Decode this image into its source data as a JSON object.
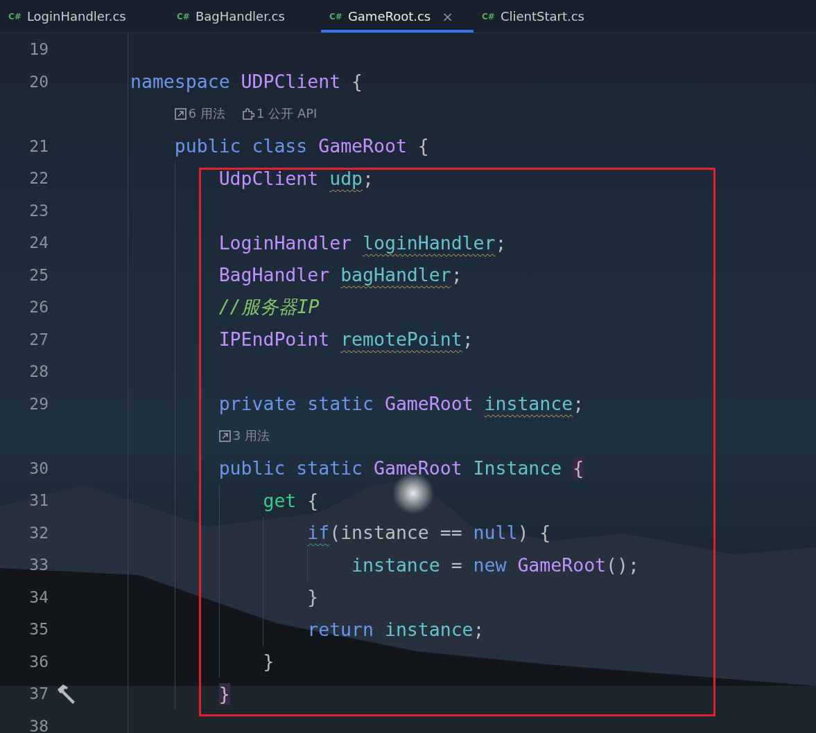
{
  "tabs": [
    {
      "label": "LoginHandler.cs",
      "badge": "C#",
      "selected": false
    },
    {
      "label": "BagHandler.cs",
      "badge": "C#",
      "selected": false
    },
    {
      "label": "GameRoot.cs",
      "badge": "C#",
      "selected": true,
      "close": "×"
    },
    {
      "label": "ClientStart.cs",
      "badge": "C#",
      "selected": false
    }
  ],
  "lines": [
    {
      "kind": "code",
      "number": "19"
    },
    {
      "kind": "code",
      "number": "20",
      "tokens": [
        {
          "text": "namespace",
          "kind": "keyword"
        },
        {
          "text": "UDPClient",
          "kind": "type"
        },
        {
          "text": "{",
          "kind": "punct"
        }
      ],
      "children": [
        {
          "kind": "hint",
          "hints": [
            {
              "kind": "usages",
              "text": "6 用法"
            },
            {
              "kind": "api",
              "text": "1 公开 API"
            }
          ]
        },
        {
          "kind": "code",
          "number": "21",
          "tokens": [
            {
              "text": "public",
              "kind": "keyword"
            },
            {
              "text": "class",
              "kind": "keyword"
            },
            {
              "text": "GameRoot",
              "kind": "type"
            },
            {
              "text": "{",
              "kind": "punct"
            }
          ],
          "children": [
            {
              "kind": "code",
              "number": "22",
              "tokens": [
                {
                  "text": "UdpClient",
                  "kind": "type"
                },
                {
                  "text": "udp",
                  "kind": "field",
                  "squiggly": true,
                  "after": ";"
                }
              ]
            },
            {
              "kind": "code",
              "number": "23"
            },
            {
              "kind": "code",
              "number": "24",
              "tokens": [
                {
                  "text": "LoginHandler",
                  "kind": "type"
                },
                {
                  "text": "loginHandler",
                  "kind": "field",
                  "squiggly": true,
                  "after": ";"
                }
              ]
            },
            {
              "kind": "code",
              "number": "25",
              "tokens": [
                {
                  "text": "BagHandler",
                  "kind": "type"
                },
                {
                  "text": "bagHandler",
                  "kind": "field",
                  "squiggly": true,
                  "after": ";"
                }
              ]
            },
            {
              "kind": "code",
              "number": "26",
              "tokens": [
                {
                  "text": "//服务器IP",
                  "kind": "comment"
                }
              ]
            },
            {
              "kind": "code",
              "number": "27",
              "tokens": [
                {
                  "text": "IPEndPoint",
                  "kind": "type"
                },
                {
                  "text": "remotePoint",
                  "kind": "field",
                  "squiggly": true,
                  "after": ";"
                }
              ]
            },
            {
              "kind": "code",
              "number": "28"
            },
            {
              "kind": "code",
              "number": "29",
              "tokens": [
                {
                  "text": "private",
                  "kind": "keyword"
                },
                {
                  "text": "static",
                  "kind": "keyword"
                },
                {
                  "text": "GameRoot",
                  "kind": "type"
                },
                {
                  "text": "instance",
                  "kind": "field",
                  "squiggly": true,
                  "after": ";"
                }
              ]
            },
            {
              "kind": "hint",
              "hints": [
                {
                  "kind": "usages",
                  "text": "3 用法"
                }
              ]
            },
            {
              "kind": "code",
              "number": "30",
              "tokens": [
                {
                  "text": "public",
                  "kind": "keyword"
                },
                {
                  "text": "static",
                  "kind": "keyword"
                },
                {
                  "text": "GameRoot",
                  "kind": "type"
                },
                {
                  "text": "Instance",
                  "kind": "field"
                },
                {
                  "text": "{",
                  "kind": "punct",
                  "matched": true
                }
              ],
              "children": [
                {
                  "kind": "code",
                  "number": "31",
                  "tokens": [
                    {
                      "text": "get",
                      "kind": "accessor"
                    },
                    {
                      "text": "{",
                      "kind": "punct"
                    }
                  ],
                  "children": [
                    {
                      "kind": "code",
                      "number": "32",
                      "tokens": [
                        {
                          "text": "if",
                          "kind": "keyword",
                          "squiggly": true,
                          "after": "(instance"
                        },
                        {
                          "text": "==",
                          "kind": "punct"
                        },
                        {
                          "text": "null",
                          "kind": "keyword",
                          "after": ")"
                        },
                        {
                          "text": "{",
                          "kind": "punct"
                        }
                      ],
                      "children": [
                        {
                          "kind": "code",
                          "number": "33",
                          "tokens": [
                            {
                              "text": "instance",
                              "kind": "field"
                            },
                            {
                              "text": "=",
                              "kind": "punct"
                            },
                            {
                              "text": "new",
                              "kind": "keyword"
                            },
                            {
                              "text": "GameRoot",
                              "kind": "type",
                              "after": "();"
                            }
                          ]
                        }
                      ]
                    },
                    {
                      "kind": "code",
                      "number": "34",
                      "tokens": [
                        {
                          "text": "}",
                          "kind": "punct"
                        }
                      ]
                    },
                    {
                      "kind": "code",
                      "number": "35",
                      "tokens": [
                        {
                          "text": "return",
                          "kind": "keyword"
                        },
                        {
                          "text": "instance",
                          "kind": "field",
                          "after": ";"
                        }
                      ]
                    }
                  ]
                },
                {
                  "kind": "code",
                  "number": "36",
                  "tokens": [
                    {
                      "text": "}",
                      "kind": "punct"
                    }
                  ]
                }
              ]
            },
            {
              "kind": "code",
              "number": "37",
              "build_icon": true,
              "tokens": [
                {
                  "text": "}",
                  "kind": "punct",
                  "matched": true
                }
              ]
            }
          ]
        }
      ]
    },
    {
      "kind": "code",
      "number": "38"
    }
  ]
}
